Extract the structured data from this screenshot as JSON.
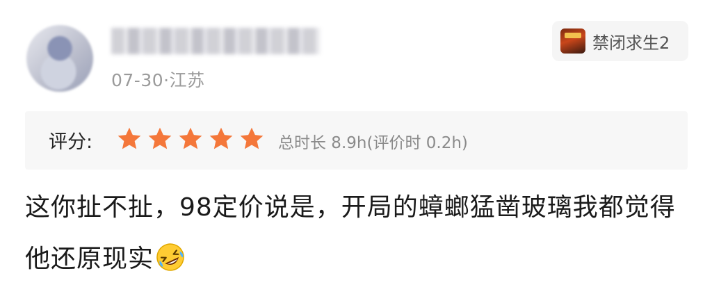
{
  "user": {
    "date_location": "07-30·江苏"
  },
  "game_tag": {
    "name": "禁闭求生2",
    "icon": "game-cover-icon"
  },
  "rating": {
    "label": "评分:",
    "stars": 5,
    "max_stars": 5,
    "star_color": "#f4773a",
    "playtime": "总时长 8.9h(评价时 0.2h)"
  },
  "review": {
    "text": "这你扯不扯，98定价说是，开局的蟑螂猛凿玻璃我都觉得他还原现实",
    "emoji": "rolling-on-floor-laughing-emoji"
  }
}
